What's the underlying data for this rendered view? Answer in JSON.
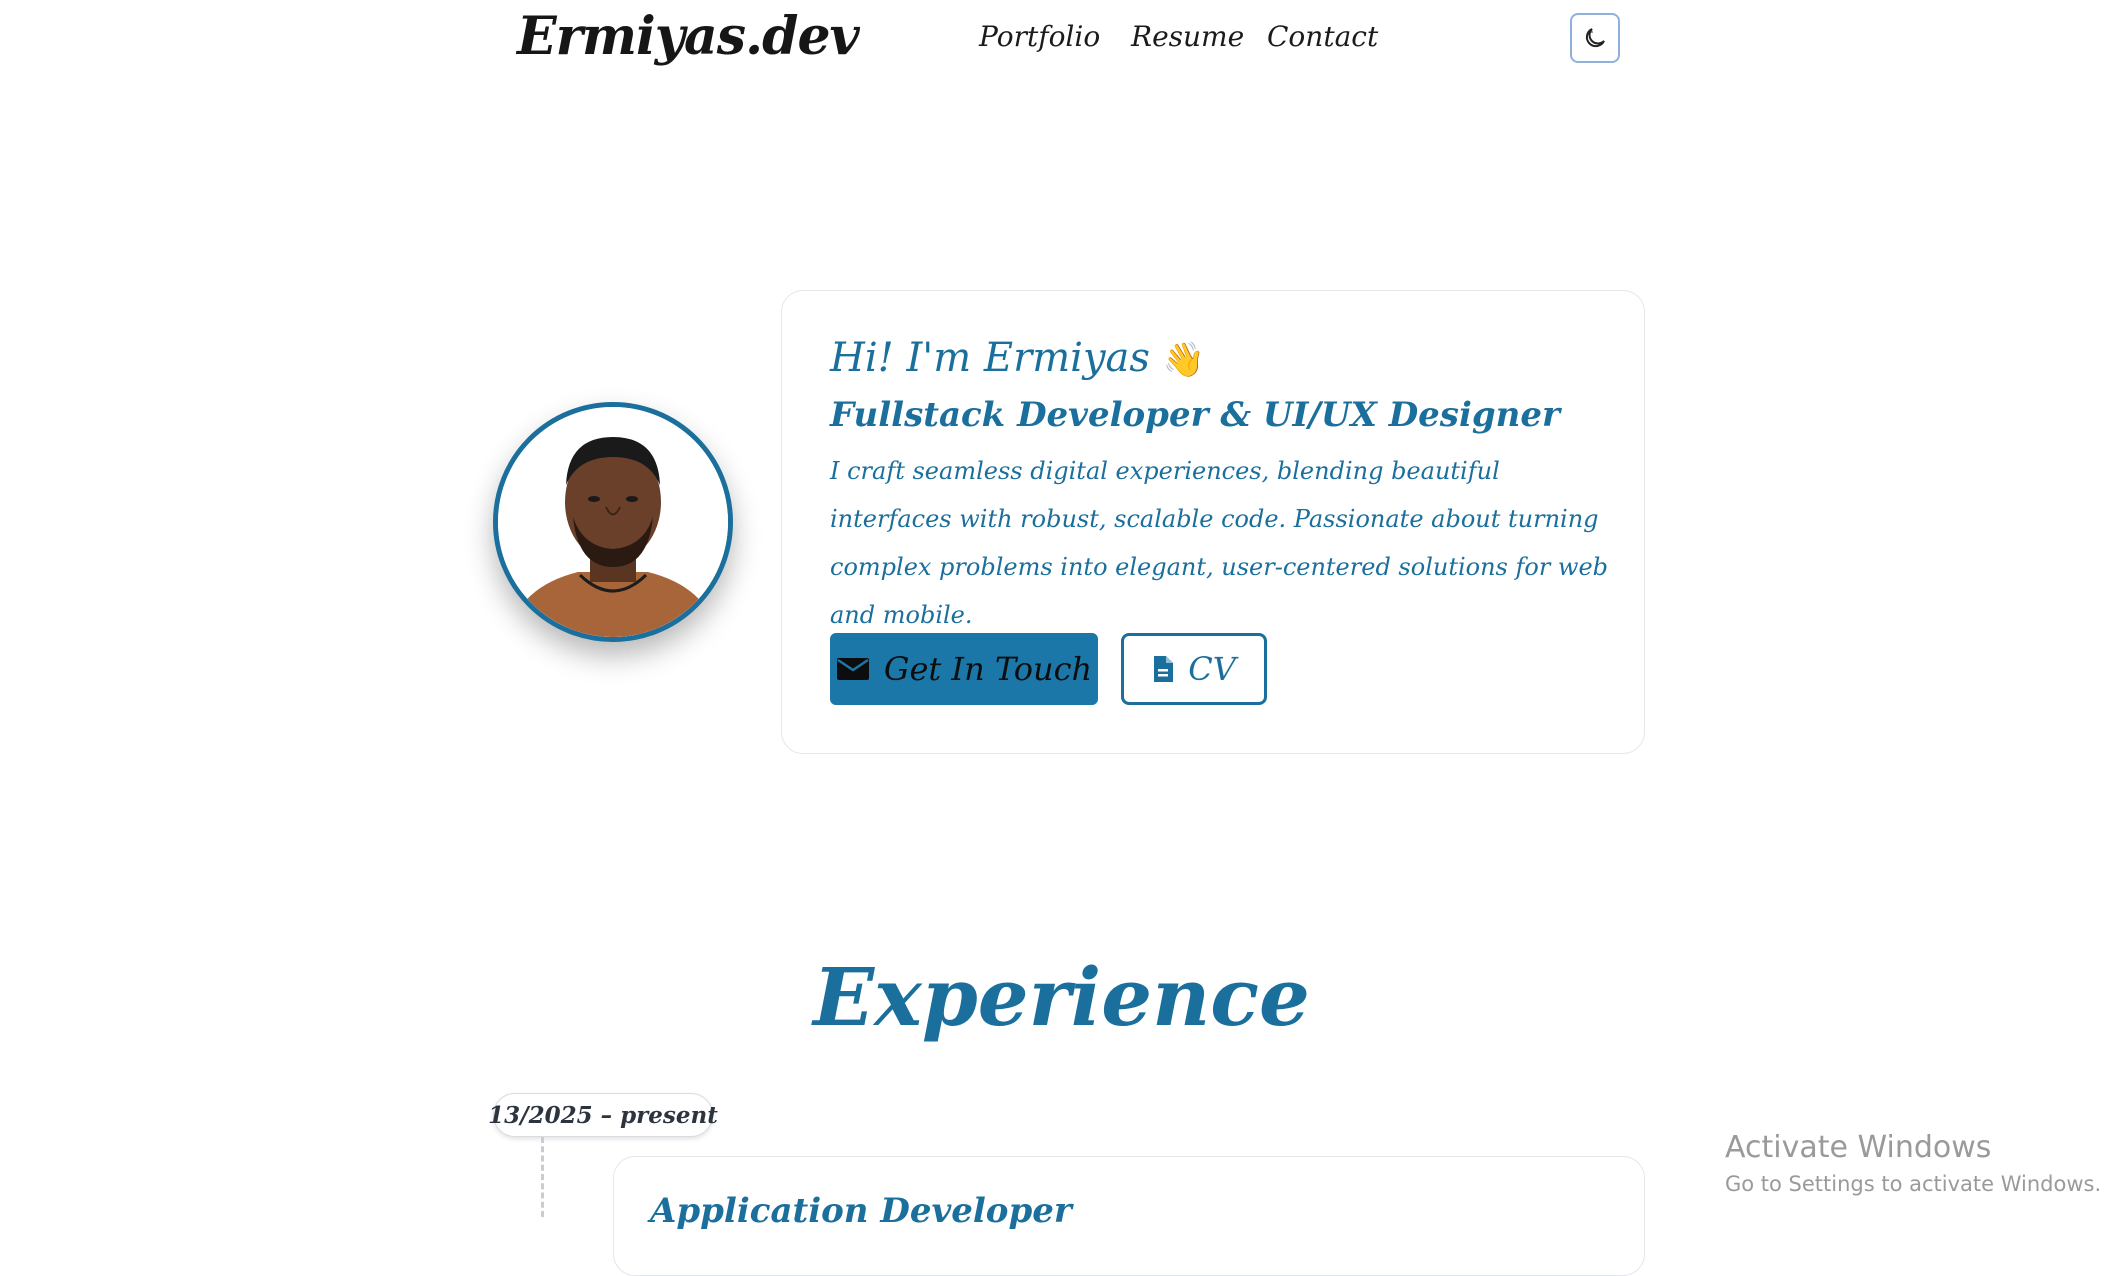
{
  "header": {
    "logo": "Ermiyas.dev",
    "nav": [
      "Portfolio",
      "Resume",
      "Contact"
    ],
    "theme_toggle_icon": "moon-icon"
  },
  "hero": {
    "greeting": "Hi! I'm Ermiyas",
    "greeting_emoji": "👋",
    "role": "Fullstack Developer & UI/UX Designer",
    "description": "I craft seamless digital experiences, blending beautiful interfaces with robust, scalable code. Passionate about turning complex problems into elegant, user-centered solutions for web and mobile.",
    "cta_primary": "Get In Touch",
    "cta_primary_icon": "envelope-icon",
    "cta_secondary": "CV",
    "cta_secondary_icon": "document-icon"
  },
  "experience": {
    "title": "Experience",
    "items": [
      {
        "date": "13/2025 – present",
        "role": "Application Developer"
      }
    ]
  },
  "watermark": {
    "title": "Activate Windows",
    "subtitle": "Go to Settings to activate Windows."
  },
  "colors": {
    "accent": "#1b6f9c",
    "button_bg": "#1b77a8",
    "border": "#e3e6ea"
  }
}
